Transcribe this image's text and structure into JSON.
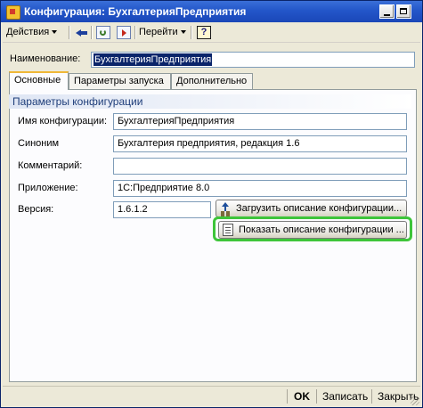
{
  "window": {
    "title": "Конфигурация: БухгалтерияПредприятия"
  },
  "toolbar": {
    "actions_label": "Действия",
    "goto_label": "Перейти",
    "help_label": "?",
    "icons": [
      "back-arrow-icon",
      "refresh-icon",
      "goto-icon",
      "help-icon"
    ]
  },
  "name": {
    "label": "Наименование:",
    "value": "БухгалтерияПредприятия"
  },
  "tabs": [
    {
      "label": "Основные",
      "active": true
    },
    {
      "label": "Параметры запуска",
      "active": false
    },
    {
      "label": "Дополнительно",
      "active": false
    }
  ],
  "group": {
    "title": "Параметры конфигурации"
  },
  "fields": {
    "config_name": {
      "label": "Имя конфигурации:",
      "value": "БухгалтерияПредприятия"
    },
    "synonym": {
      "label": "Синоним",
      "value": "Бухгалтерия предприятия, редакция 1.6"
    },
    "comment": {
      "label": "Комментарий:",
      "value": ""
    },
    "application": {
      "label": "Приложение:",
      "value": "1С:Предприятие 8.0"
    },
    "version": {
      "label": "Версия:",
      "value": "1.6.1.2"
    }
  },
  "buttons": {
    "load_description": "Загрузить описание конфигурации...",
    "show_description": "Показать описание конфигурации ..."
  },
  "bottom": {
    "ok": "OK",
    "save": "Записать",
    "close": "Закрыть"
  },
  "colors": {
    "title_bar": "#2356c9",
    "highlight": "#3ec53a",
    "selection": "#0a246a",
    "tab_accent": "#f0b838"
  }
}
